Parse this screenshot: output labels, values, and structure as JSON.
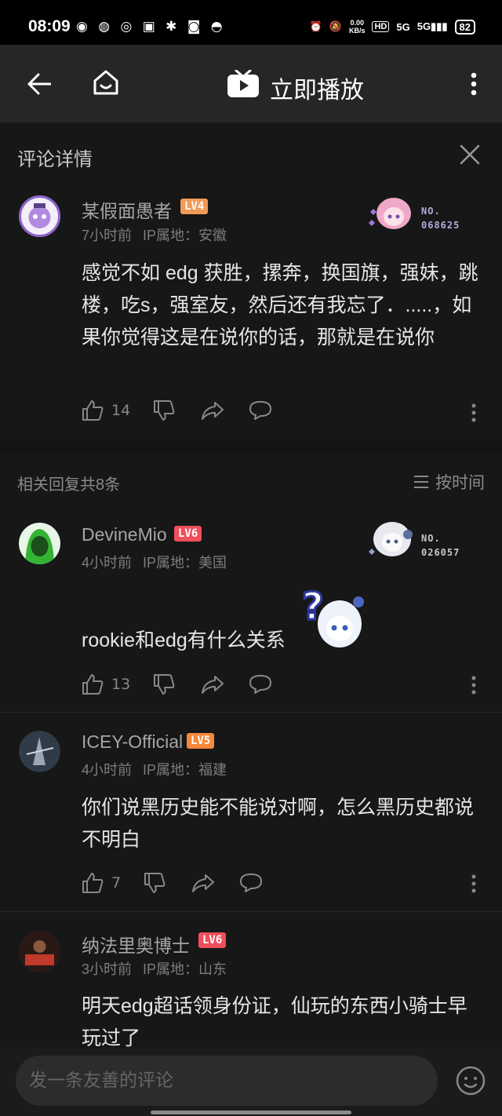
{
  "status": {
    "time": "08:09",
    "network_speed": "0.00\nKB/s",
    "battery": "82",
    "signal": "5G"
  },
  "topbar": {
    "title": "立即播放"
  },
  "comment_detail": {
    "section_title": "评论详情",
    "main": {
      "username": "某假面愚者",
      "level": "LV4",
      "time": "7小时前",
      "ip": "IP属地：安徽",
      "badge_no": "NO.\n068625",
      "content": "感觉不如 edg 获胜，摞奔，换国旗，强妹，跳楼，吃s，强室友，然后还有我忘了．.....，如果你觉得这是在说你的话，那就是在说你",
      "likes": "14"
    },
    "replies_header": {
      "count_label": "相关回复共8条",
      "sort_label": "按时间"
    },
    "replies": [
      {
        "username": "DevineMio",
        "level": "LV6",
        "time": "4小时前",
        "ip": "IP属地：美国",
        "badge_no": "NO.\n026057",
        "content": "rookie和edg有什么关系",
        "likes": "13"
      },
      {
        "username": "ICEY-Official",
        "level": "LV5",
        "time": "4小时前",
        "ip": "IP属地：福建",
        "content": "你们说黑历史能不能说对啊，怎么黑历史都说不明白",
        "likes": "7"
      },
      {
        "username": "纳法里奥博士",
        "level": "LV6",
        "time": "3小时前",
        "ip": "IP属地：山东",
        "content": "明天edg超话领身份证，仙玩的东西小骑士早玩过了"
      }
    ]
  },
  "composer": {
    "placeholder": "发一条友善的评论"
  },
  "colors": {
    "lv4": "#f29a57",
    "lv5": "#f5883c",
    "lv6": "#f04e5a",
    "no_text": "#b7a6df"
  }
}
